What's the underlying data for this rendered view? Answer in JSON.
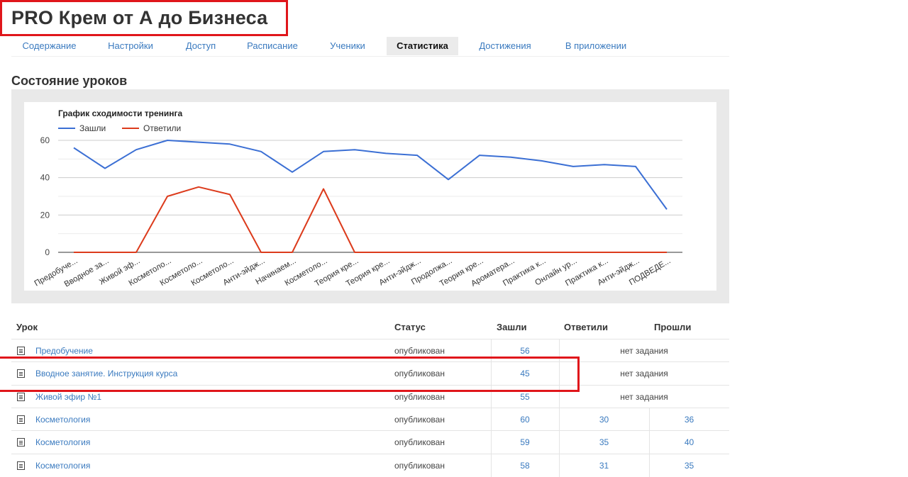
{
  "page": {
    "title": "PRO Крем от А до Бизнеса"
  },
  "tabs": [
    {
      "label": "Содержание",
      "active": false
    },
    {
      "label": "Настройки",
      "active": false
    },
    {
      "label": "Доступ",
      "active": false
    },
    {
      "label": "Расписание",
      "active": false
    },
    {
      "label": "Ученики",
      "active": false
    },
    {
      "label": "Статистика",
      "active": true
    },
    {
      "label": "Достижения",
      "active": false
    },
    {
      "label": "В приложении",
      "active": false
    }
  ],
  "section": {
    "title": "Состояние уроков"
  },
  "chart_data": {
    "type": "line",
    "title": "График сходимости тренинга",
    "categories": [
      "Предобуче...",
      "Вводное за...",
      "Живой эф...",
      "Косметоло...",
      "Косметоло...",
      "Косметоло...",
      "Анти-эйдж...",
      "Начинаем...",
      "Косметоло...",
      "Теория кре...",
      "Теория кре...",
      "Анти-эйдж...",
      "Продолжа...",
      "Теория кре...",
      "Ароматера...",
      "Практика к...",
      "Онлайн ур...",
      "Практика к...",
      "Анти-эйдж...",
      "ПОДВЕДЕ..."
    ],
    "series": [
      {
        "name": "Зашли",
        "color": "#3b6fd4",
        "values": [
          56,
          45,
          55,
          60,
          59,
          58,
          54,
          43,
          54,
          55,
          53,
          52,
          39,
          52,
          51,
          49,
          46,
          47,
          46,
          23
        ]
      },
      {
        "name": "Ответили",
        "color": "#dc3b1c",
        "values": [
          0,
          0,
          0,
          30,
          35,
          31,
          0,
          0,
          34,
          0,
          0,
          0,
          0,
          0,
          0,
          0,
          0,
          0,
          0,
          0
        ]
      }
    ],
    "yticks": [
      0,
      20,
      40,
      60
    ],
    "ylim": [
      0,
      60
    ],
    "grid": true,
    "legend": "top-left"
  },
  "table": {
    "headers": {
      "lesson": "Урок",
      "status": "Статус",
      "visited": "Зашли",
      "answered": "Ответили",
      "passed": "Прошли"
    },
    "rows": [
      {
        "lesson": "Предобучение",
        "status": "опубликован",
        "visited": "56",
        "answered": "",
        "passed": "",
        "no_task": "нет задания"
      },
      {
        "lesson": "Вводное занятие. Инструкция курса",
        "status": "опубликован",
        "visited": "45",
        "answered": "",
        "passed": "",
        "no_task": "нет задания"
      },
      {
        "lesson": "Живой эфир №1",
        "status": "опубликован",
        "visited": "55",
        "answered": "",
        "passed": "",
        "no_task": "нет задания"
      },
      {
        "lesson": "Косметология",
        "status": "опубликован",
        "visited": "60",
        "answered": "30",
        "passed": "36",
        "no_task": ""
      },
      {
        "lesson": "Косметология",
        "status": "опубликован",
        "visited": "59",
        "answered": "35",
        "passed": "40",
        "no_task": ""
      },
      {
        "lesson": "Косметология",
        "status": "опубликован",
        "visited": "58",
        "answered": "31",
        "passed": "35",
        "no_task": ""
      }
    ]
  },
  "colors": {
    "link": "#3a7abf",
    "highlight": "#e0161b",
    "series_visited": "#3b6fd4",
    "series_answered": "#dc3b1c"
  }
}
